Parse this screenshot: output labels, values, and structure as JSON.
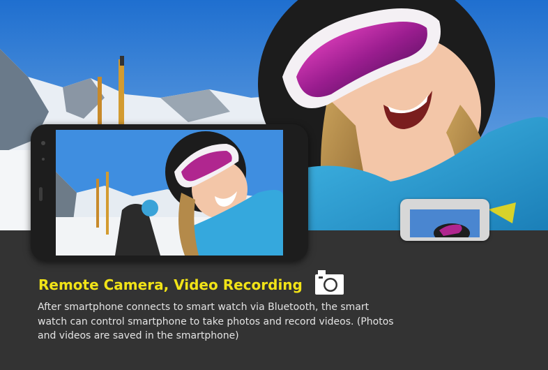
{
  "feature": {
    "title": "Remote Camera, Video Recording",
    "description": "After smartphone connects to smart watch via Bluetooth, the smart watch can control smartphone to take photos and record videos. (Photos and videos are saved in the smartphone)",
    "icon": "camera-icon"
  },
  "colors": {
    "title": "#f1e317",
    "body_text": "#e4e4e4",
    "panel_background": "#333333",
    "sky": "#2f7fd6"
  },
  "photo": {
    "subject": "skier selfie with pink goggles",
    "devices": [
      "smartphone-mockup",
      "smartwatch-mockup"
    ]
  }
}
